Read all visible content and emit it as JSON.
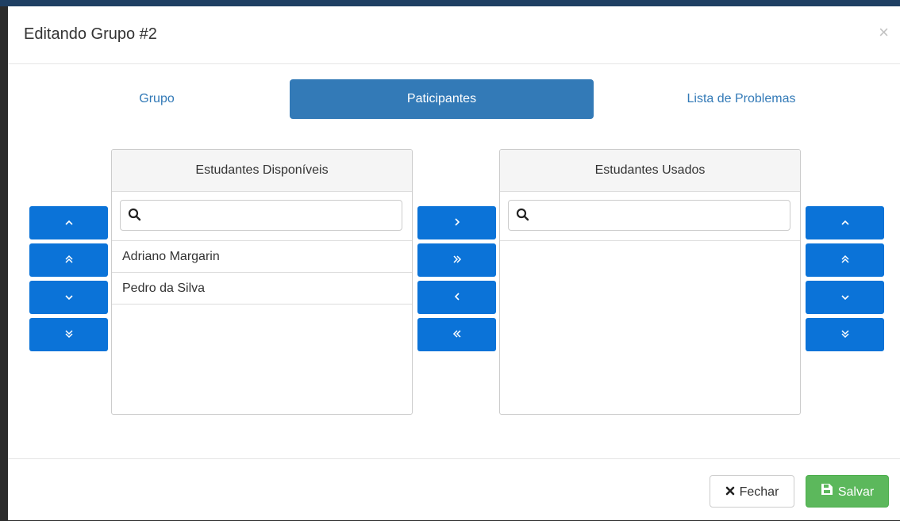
{
  "modal": {
    "title": "Editando Grupo #2",
    "close_glyph": "×"
  },
  "tabs": [
    {
      "label": "Grupo",
      "active": false
    },
    {
      "label": "Paticipantes",
      "active": true
    },
    {
      "label": "Lista de Problemas",
      "active": false
    }
  ],
  "available": {
    "heading": "Estudantes Disponíveis",
    "search_value": "",
    "items": [
      "Adriano Margarin",
      "Pedro da Silva"
    ]
  },
  "used": {
    "heading": "Estudantes Usados",
    "search_value": "",
    "items": []
  },
  "reorder_buttons": [
    {
      "glyph": "˄",
      "icon": "chevron-up-icon"
    },
    {
      "glyph": "»",
      "icon": "double-chevron-up-icon"
    },
    {
      "glyph": "˅",
      "icon": "chevron-down-icon"
    },
    {
      "glyph": "»",
      "icon": "double-chevron-down-icon"
    }
  ],
  "transfer_buttons": [
    {
      "glyph": "›",
      "icon": "chevron-right-icon"
    },
    {
      "glyph": "»",
      "icon": "double-chevron-right-icon"
    },
    {
      "glyph": "‹",
      "icon": "chevron-left-icon"
    },
    {
      "glyph": "«",
      "icon": "double-chevron-left-icon"
    }
  ],
  "footer": {
    "close_label": "Fechar",
    "close_icon": "times-icon",
    "save_label": "Salvar",
    "save_icon": "save-icon"
  },
  "colors": {
    "primary": "#337ab7",
    "button_blue": "#0b73d8",
    "success": "#5cb85c"
  }
}
